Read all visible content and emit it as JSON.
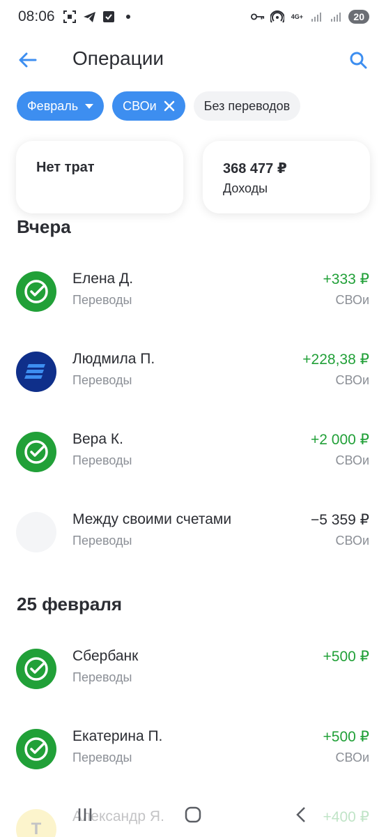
{
  "status_bar": {
    "time": "08:06",
    "network_label": "4G+",
    "battery": "20"
  },
  "header": {
    "title": "Операции",
    "back_icon": "arrow-left-icon",
    "search_icon": "search-icon",
    "accent_color": "#3d8ef0"
  },
  "filters": {
    "month": "Февраль",
    "account": "СВОи",
    "transfers": "Без переводов"
  },
  "summary": {
    "expenses_label": "Нет трат",
    "income_amount": "368 477 ₽",
    "income_label": "Доходы"
  },
  "sections": [
    {
      "title": "Вчера",
      "items": [
        {
          "name": "Елена Д.",
          "category": "Переводы",
          "amount": "+333 ₽",
          "account": "СВОи",
          "avatar": "sber-check-icon"
        },
        {
          "name": "Людмила П.",
          "category": "Переводы",
          "amount": "+228,38 ₽",
          "account": "СВОи",
          "avatar": "bank-stripes-icon"
        },
        {
          "name": "Вера К.",
          "category": "Переводы",
          "amount": "+2 000 ₽",
          "account": "СВОи",
          "avatar": "sber-check-icon"
        },
        {
          "name": "Между своими счетами",
          "category": "Переводы",
          "amount": "−5 359 ₽",
          "account": "СВОи",
          "avatar": "empty-avatar"
        }
      ]
    },
    {
      "title": "25 февраля",
      "items": [
        {
          "name": "Сбербанк",
          "category": "Переводы",
          "amount": "+500 ₽",
          "account": "",
          "avatar": "sber-check-icon"
        },
        {
          "name": "Екатерина П.",
          "category": "Переводы",
          "amount": "+500 ₽",
          "account": "СВОи",
          "avatar": "sber-check-icon"
        },
        {
          "name": "Александр Я.",
          "category": "",
          "amount": "+400 ₽",
          "account": "",
          "avatar": "tinkoff-icon",
          "avatar_letter": "Т"
        }
      ]
    }
  ],
  "colors": {
    "positive": "#21a038",
    "sber_green": "#21a038",
    "navy": "#0f2f8a",
    "chip_blue": "#3d8ef0"
  }
}
